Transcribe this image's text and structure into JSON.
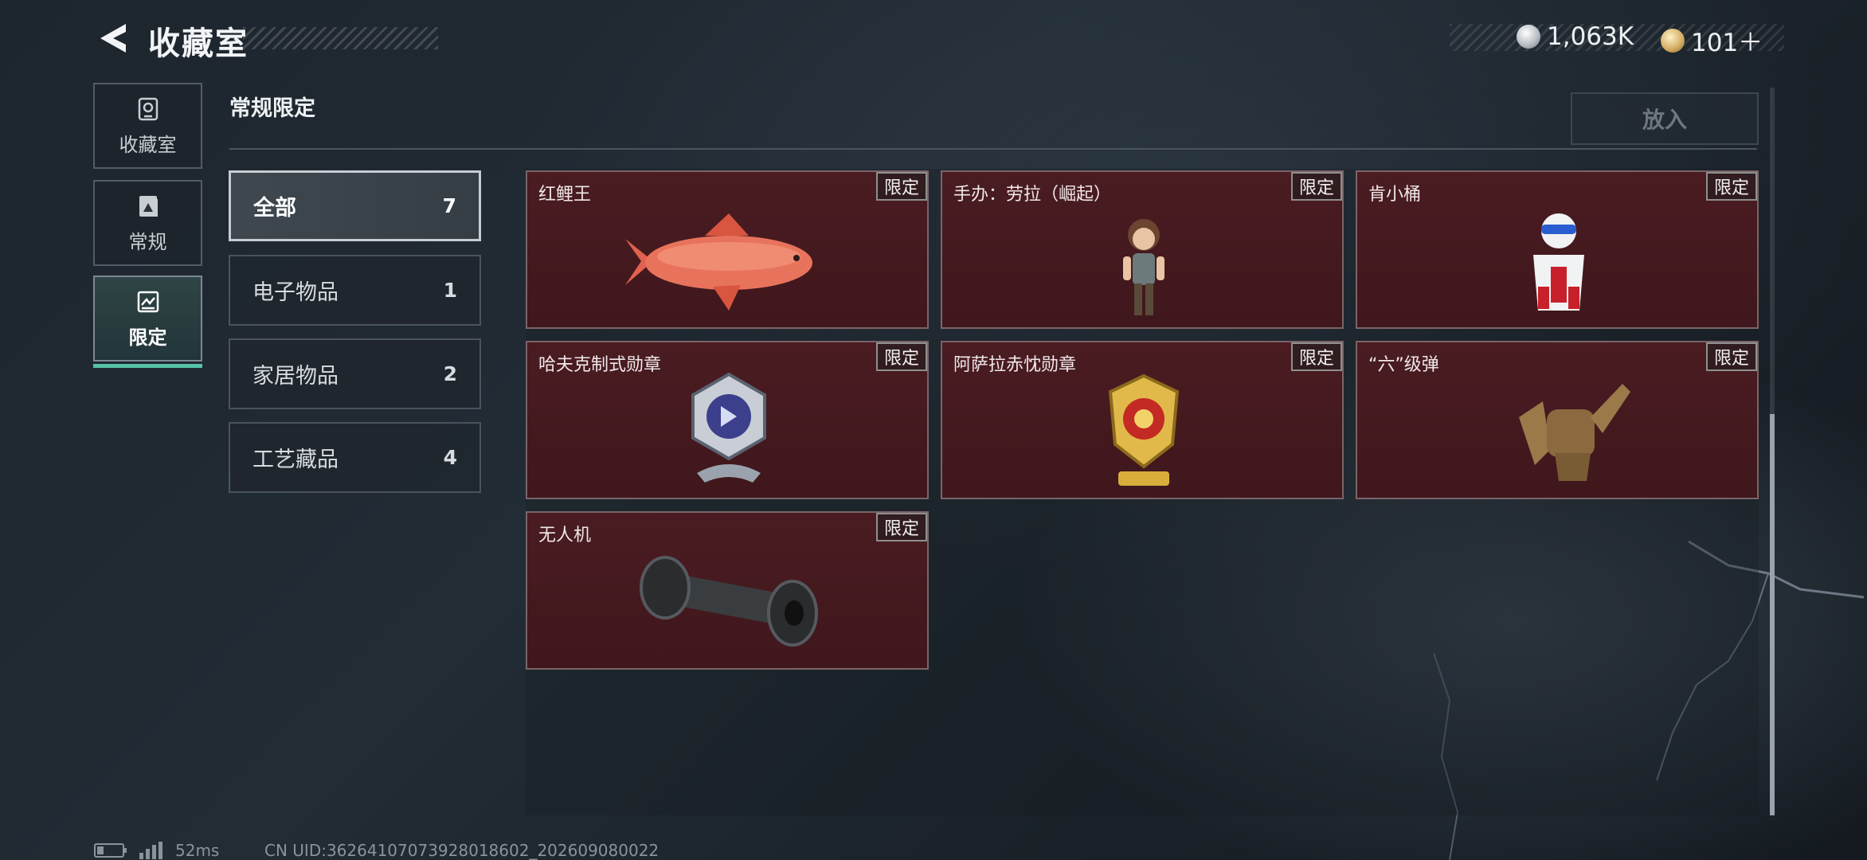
{
  "header": {
    "title": "收藏室",
    "currency_silver": "1,063K",
    "currency_gold": "101＋"
  },
  "sidebar": {
    "items": [
      {
        "label": "收藏室",
        "icon": "vault-icon"
      },
      {
        "label": "常规",
        "icon": "regular-icon"
      },
      {
        "label": "限定",
        "icon": "limited-icon",
        "active": true
      }
    ]
  },
  "section": {
    "title": "常规限定",
    "place_button": "放入"
  },
  "categories": [
    {
      "label": "全部",
      "count": "7",
      "active": true
    },
    {
      "label": "电子物品",
      "count": "1"
    },
    {
      "label": "家居物品",
      "count": "2"
    },
    {
      "label": "工艺藏品",
      "count": "4"
    }
  ],
  "items": [
    {
      "name": "红鲤王",
      "badge": "限定",
      "icon": "koi-fish-icon"
    },
    {
      "name": "手办：劳拉（崛起）",
      "badge": "限定",
      "icon": "lara-figure-icon"
    },
    {
      "name": "肯小桶",
      "badge": "限定",
      "icon": "bucket-mascot-icon"
    },
    {
      "name": "哈夫克制式勋章",
      "badge": "限定",
      "icon": "haavk-medal-icon"
    },
    {
      "name": "阿萨拉赤忱勋章",
      "badge": "限定",
      "icon": "asara-medal-icon"
    },
    {
      "name": "“六”级弹",
      "badge": "限定",
      "icon": "hand-gesture-icon"
    },
    {
      "name": "无人机",
      "badge": "限定",
      "icon": "drone-icon"
    }
  ],
  "footer": {
    "ping": "52ms",
    "uid": "CN UID:36264107073928018602_202609080022"
  },
  "colors": {
    "accent": "#56c3a8",
    "card_bg": "#4a1c22",
    "background": "#1d252d"
  }
}
